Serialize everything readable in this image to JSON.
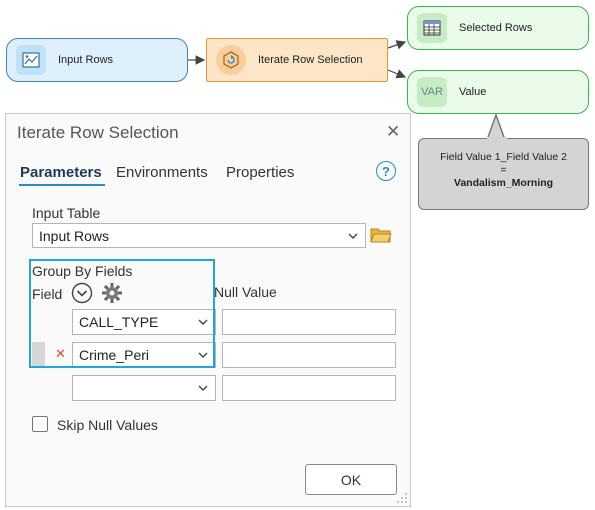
{
  "model": {
    "input_node": {
      "label": "Input Rows",
      "icon": "table-view-icon"
    },
    "tool_node": {
      "label": "Iterate Row Selection",
      "icon": "iterate-tool-icon"
    },
    "output_selected": {
      "label": "Selected Rows",
      "icon": "table-icon"
    },
    "output_value": {
      "label": "Value",
      "icon": "variable-icon",
      "icon_text": "VAR"
    },
    "tooltip": {
      "line1": "Field Value 1_Field Value 2",
      "line2": "=",
      "line3": "Vandalism_Morning"
    }
  },
  "dialog": {
    "title": "Iterate Row Selection",
    "tabs": [
      {
        "label": "Parameters",
        "active": true
      },
      {
        "label": "Environments",
        "active": false
      },
      {
        "label": "Properties",
        "active": false
      }
    ],
    "help_label": "?",
    "input_table": {
      "label": "Input Table",
      "value": "Input Rows"
    },
    "group_by": {
      "label": "Group By Fields",
      "field_header": "Field",
      "null_header": "Null Value",
      "rows": [
        {
          "field": "CALL_TYPE",
          "null_value": ""
        },
        {
          "field": "Crime_Peri",
          "null_value": ""
        },
        {
          "field": "",
          "null_value": ""
        }
      ],
      "remove_symbol": "✕"
    },
    "skip_null": {
      "label": "Skip Null Values",
      "checked": false
    },
    "ok_label": "OK"
  },
  "colors": {
    "data_fill": "#ddf0fb",
    "data_border": "#3a86c8",
    "tool_fill": "#fde6c8",
    "tool_border": "#e39a34",
    "output_fill": "#eafbe9",
    "output_border": "#3ab54a",
    "highlight": "#22a6d8",
    "accent": "#2a8ac4"
  }
}
